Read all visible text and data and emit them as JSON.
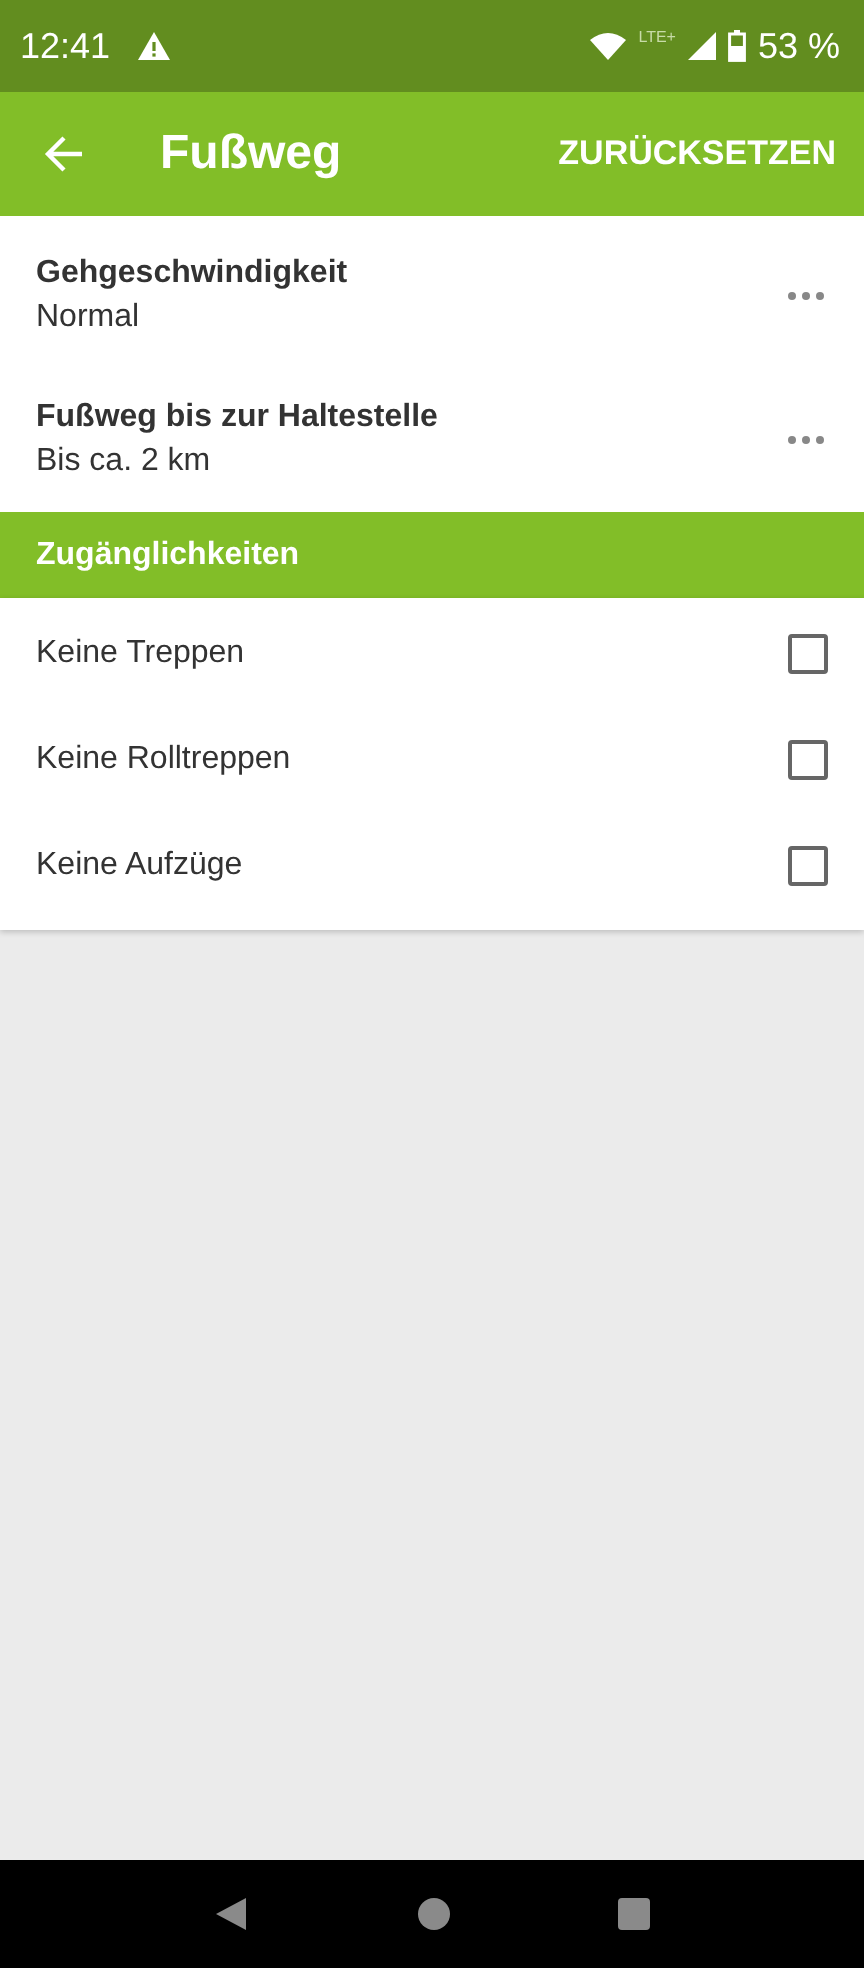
{
  "status_bar": {
    "time": "12:41",
    "network": "LTE+",
    "battery": "53 %"
  },
  "app_bar": {
    "title": "Fußweg",
    "action": "ZURÜCKSETZEN"
  },
  "settings": [
    {
      "title": "Gehgeschwindigkeit",
      "value": "Normal"
    },
    {
      "title": "Fußweg bis zur Haltestelle",
      "value": "Bis ca. 2 km"
    }
  ],
  "section": {
    "title": "Zugänglichkeiten"
  },
  "options": [
    {
      "label": "Keine Treppen",
      "checked": false
    },
    {
      "label": "Keine Rolltreppen",
      "checked": false
    },
    {
      "label": "Keine Aufzüge",
      "checked": false
    }
  ]
}
